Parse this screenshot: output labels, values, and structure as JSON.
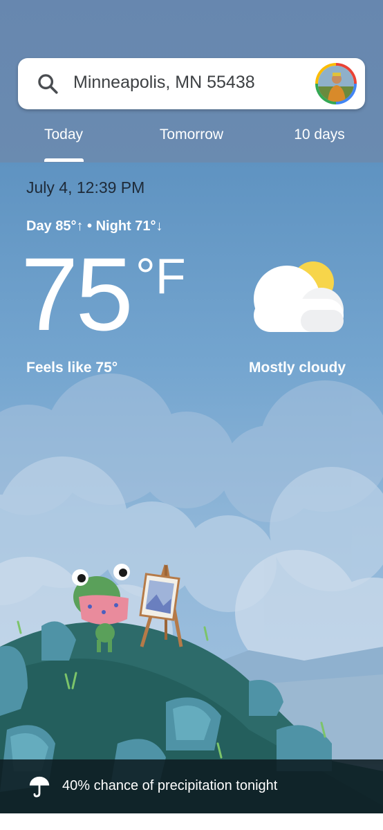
{
  "search": {
    "location": "Minneapolis, MN 55438"
  },
  "tabs": [
    {
      "label": "Today"
    },
    {
      "label": "Tomorrow"
    },
    {
      "label": "10 days"
    }
  ],
  "current": {
    "date_time": "July 4, 12:39 PM",
    "day_night": "Day 85°↑ • Night 71°↓",
    "temperature": "75",
    "unit": "°F",
    "feels_like": "Feels like 75°",
    "condition": "Mostly cloudy"
  },
  "precipitation": {
    "text": "40% chance of precipitation tonight"
  },
  "icons": {
    "search": "search-icon",
    "weather": "partly-cloudy-icon",
    "umbrella": "umbrella-icon"
  },
  "colors": {
    "header": "#6a8bb0",
    "sky_top": "#5f93c1",
    "hill": "#2e6f6c",
    "sun": "#f7d54a"
  }
}
